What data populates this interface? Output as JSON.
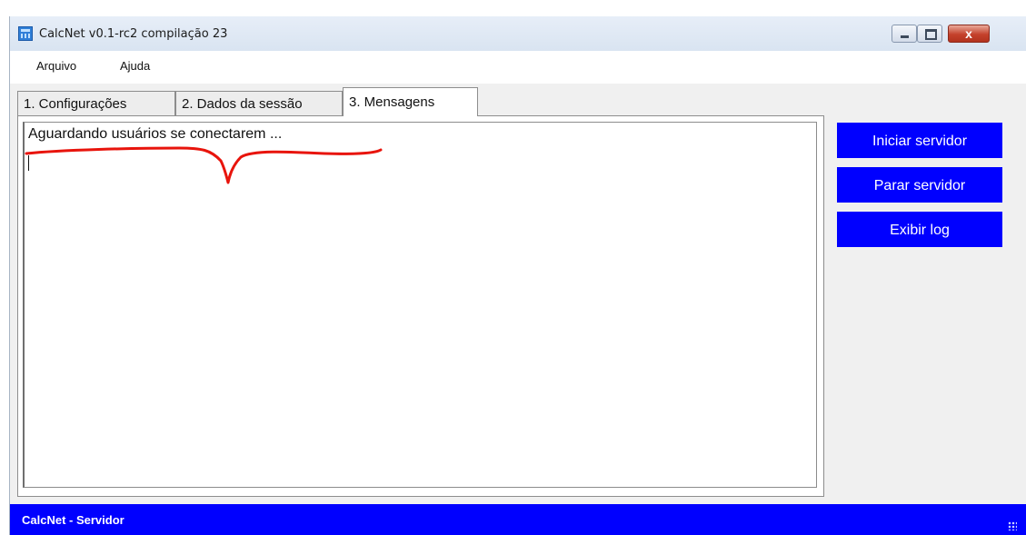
{
  "window": {
    "title": "CalcNet v0.1-rc2 compilação 23",
    "close_glyph": "x"
  },
  "menu": {
    "items": [
      {
        "label": "Arquivo"
      },
      {
        "label": "Ajuda"
      }
    ]
  },
  "tabs": [
    {
      "label": "1. Configurações",
      "active": false
    },
    {
      "label": "2. Dados da sessão",
      "active": false
    },
    {
      "label": "3. Mensagens",
      "active": true
    }
  ],
  "messages": {
    "text": "Aguardando usuários se conectarem ..."
  },
  "buttons": {
    "start": "Iniciar servidor",
    "stop": "Parar servidor",
    "log": "Exibir log"
  },
  "statusbar": {
    "text": "CalcNet - Servidor"
  },
  "colors": {
    "accent": "#0000ff",
    "annotation": "#e8140c"
  },
  "icons": [
    "calculator-icon",
    "minimize-icon",
    "maximize-icon",
    "close-icon",
    "resize-grip-icon"
  ]
}
